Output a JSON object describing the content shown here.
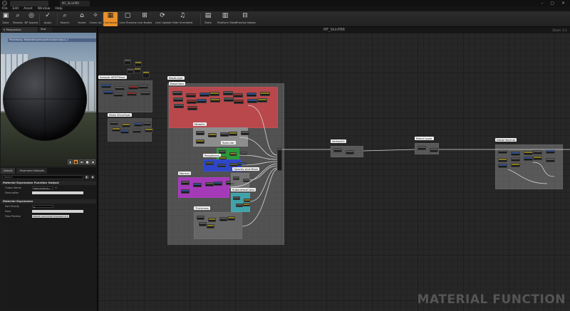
{
  "window": {
    "title_tab": "MF_SkinPBR",
    "window_controls": "– ▢ ✕"
  },
  "menu": [
    "File",
    "Edit",
    "Asset",
    "Window",
    "Help"
  ],
  "toolbar": {
    "items": [
      {
        "label": "Save",
        "icon": "save-icon",
        "glyph": "▣"
      },
      {
        "label": "Browse",
        "icon": "browse-icon",
        "glyph": "⌕"
      },
      {
        "label": "BP Aspect",
        "icon": "aspect-icon",
        "glyph": "◎"
      },
      {
        "label": "Apply",
        "icon": "apply-icon",
        "glyph": "✓"
      },
      {
        "label": "Search",
        "icon": "search-icon",
        "glyph": "⌕"
      },
      {
        "label": "Home",
        "icon": "home-icon",
        "glyph": "⌂"
      },
      {
        "label": "Clean Up",
        "icon": "cleanup-icon",
        "glyph": "✧"
      },
      {
        "label": "Connectors",
        "icon": "connectors-icon",
        "glyph": "▦"
      },
      {
        "label": "Live Preview",
        "icon": "live-preview-icon",
        "glyph": "▢"
      },
      {
        "label": "Live Nodes",
        "icon": "live-nodes-icon",
        "glyph": "⊞"
      },
      {
        "label": "Live Update",
        "icon": "live-update-icon",
        "glyph": "⟳"
      },
      {
        "label": "Hide Unrelated",
        "icon": "hide-unrelated-icon",
        "glyph": "♫"
      },
      {
        "label": "Stats",
        "icon": "stats-icon",
        "glyph": "▤"
      },
      {
        "label": "Platform Stats",
        "icon": "platform-stats-icon",
        "glyph": "▥"
      },
      {
        "label": "Preview Nodes",
        "icon": "preview-nodes-icon",
        "glyph": "⊟"
      }
    ],
    "active_index": 7
  },
  "viewport": {
    "tab_label": "Perspective",
    "tab2_label": "Stat",
    "preview_bar": "Previewing: MaterialExpressionFunctionOutput_2",
    "icons": [
      "cylinder-icon",
      "sphere-icon",
      "plane-icon",
      "cube-icon",
      "mesh-icon"
    ]
  },
  "details": {
    "tabs": [
      "Details",
      "Parameter Defaults"
    ],
    "search_placeholder": "Search",
    "sections": [
      {
        "title": "Material Expression Function Output",
        "rows": [
          {
            "key": "Output Name",
            "value": "MaterialAttribu..."
          },
          {
            "key": "Description",
            "value": ""
          }
        ]
      },
      {
        "title": "Material Expression",
        "rows": [
          {
            "key": "Sort Priority",
            "value": "0"
          },
          {
            "key": "Desc",
            "value": ""
          },
          {
            "key": "Flow Preview",
            "value": "default (Last Outer Expression) ▾"
          }
        ]
      }
    ]
  },
  "graph": {
    "title": "MF_SkinPBR",
    "zoom": "Zoom -1:1",
    "watermark": "MATERIAL FUNCTION",
    "comments": [
      {
        "label": "Sample ARDTMask"
      },
      {
        "label": "Make Mixinfloat"
      },
      {
        "label": "BaseLayer"
      },
      {
        "label": "BaseColor"
      },
      {
        "label": "Metallic"
      },
      {
        "label": "Roughness"
      },
      {
        "label": "Specular"
      },
      {
        "label": "Normal"
      },
      {
        "label": "Opacity and Mask"
      },
      {
        "label": "SubsurfaceColor"
      },
      {
        "label": "Thickness"
      },
      {
        "label": "VertexAO"
      },
      {
        "label": "Blend Layer"
      },
      {
        "label": "Detail Normal"
      }
    ]
  },
  "colors": {
    "accent": "#e8902b",
    "basecolor_group": "#b8484c",
    "metallic_group": "#8d8d8d",
    "roughness_group": "#2b9a3a",
    "specular_group": "#2e46c8",
    "normal_group": "#a43ab8",
    "subsurface_group": "#3fa3a9"
  }
}
